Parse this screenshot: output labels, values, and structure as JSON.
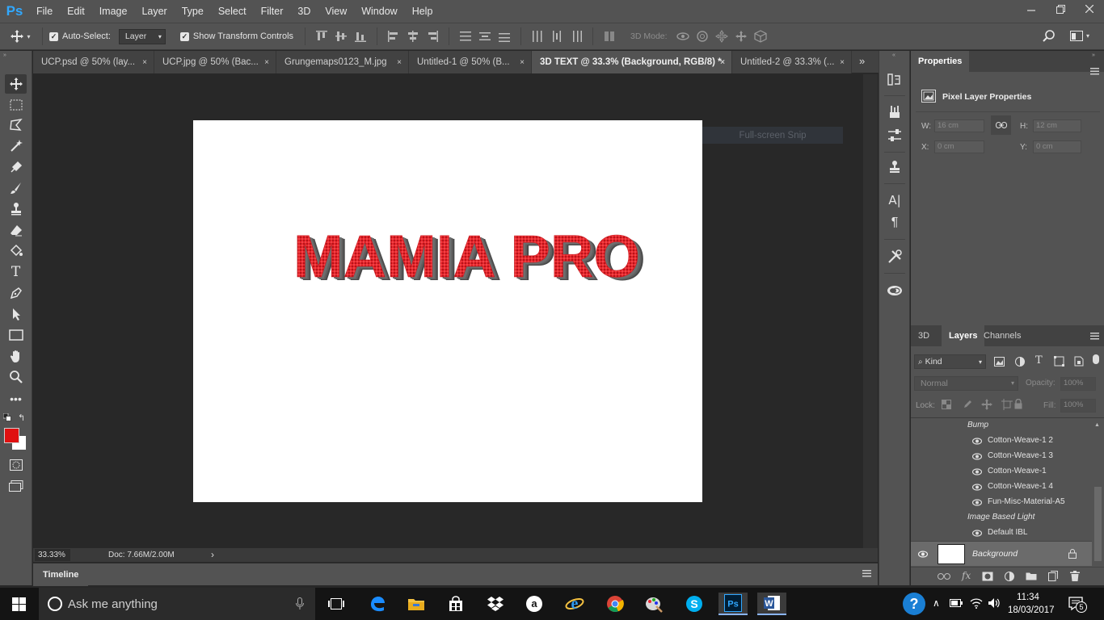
{
  "app": {
    "logo": "Ps",
    "menu": [
      "File",
      "Edit",
      "Image",
      "Layer",
      "Type",
      "Select",
      "Filter",
      "3D",
      "View",
      "Window",
      "Help"
    ],
    "window_controls": [
      "minimize-icon",
      "restore-icon",
      "close-icon"
    ]
  },
  "options_bar": {
    "auto_select_label": "Auto-Select:",
    "auto_select_checked": true,
    "layer_select_value": "Layer",
    "show_transform_label": "Show Transform Controls",
    "show_transform_checked": true,
    "mode_3d_label": "3D Mode:"
  },
  "tabs": [
    {
      "label": "UCP.psd @ 50% (lay...",
      "active": false
    },
    {
      "label": "UCP.jpg @ 50% (Bac...",
      "active": false
    },
    {
      "label": "Grungemaps0123_M.jpg",
      "active": false
    },
    {
      "label": "Untitled-1 @ 50% (B...",
      "active": false
    },
    {
      "label": "3D TEXT @ 33.3% (Background, RGB/8) *",
      "active": true
    },
    {
      "label": "Untitled-2 @ 33.3% (...",
      "active": false
    }
  ],
  "tab_close": "×",
  "tab_overflow": "»",
  "canvas": {
    "text": "MAMIA PRO",
    "text_color": "#e8262c",
    "extrusion_color": "#5c5c5c"
  },
  "overlay_snip": "Full-screen Snip",
  "status": {
    "zoom": "33.33%",
    "doc": "Doc: 7.66M/2.00M",
    "arrow": "›"
  },
  "timeline": {
    "label": "Timeline"
  },
  "colors": {
    "foreground": "#e01010",
    "background": "#ffffff",
    "accent": "#31a8ff"
  },
  "properties": {
    "title": "Properties",
    "subtitle": "Pixel Layer Properties",
    "w_label": "W:",
    "w_value": "16 cm",
    "h_label": "H:",
    "h_value": "12 cm",
    "x_label": "X:",
    "x_value": "0 cm",
    "y_label": "Y:",
    "y_value": "0 cm"
  },
  "layers_panel": {
    "tabs": [
      "3D",
      "Layers",
      "Channels"
    ],
    "active_tab": "Layers",
    "kind_label": "Kind",
    "blend_mode": "Normal",
    "opacity_label": "Opacity:",
    "opacity_value": "100%",
    "lock_label": "Lock:",
    "fill_label": "Fill:",
    "fill_value": "100%",
    "bump_label": "Bump",
    "bump_items": [
      "Cotton-Weave-1 2",
      "Cotton-Weave-1 3",
      "Cotton-Weave-1",
      "Cotton-Weave-1 4",
      "Fun-Misc-Material-A5"
    ],
    "ibl_label": "Image Based Light",
    "ibl_items": [
      "Default IBL"
    ],
    "background_layer": "Background"
  },
  "taskbar": {
    "search_placeholder": "Ask me anything",
    "time": "11:34",
    "date": "18/03/2017",
    "notifications": "5"
  }
}
